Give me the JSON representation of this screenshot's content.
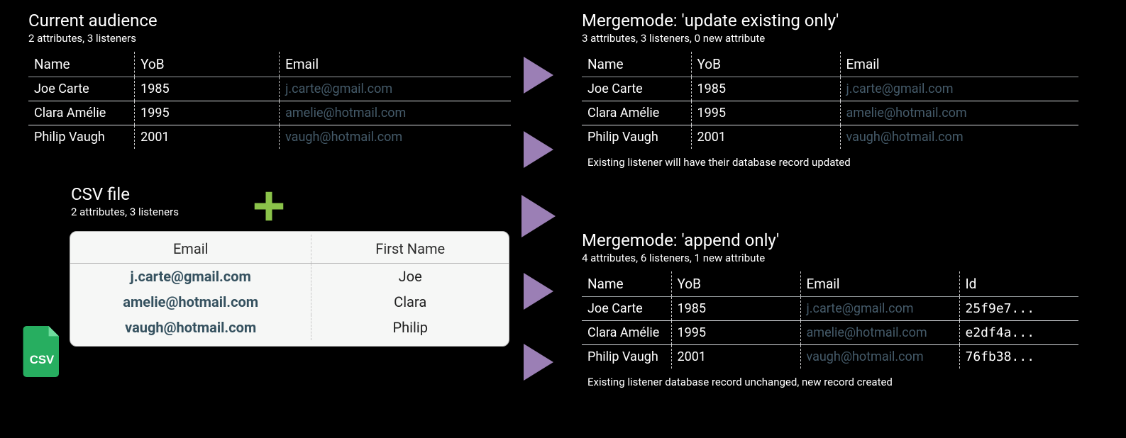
{
  "current_audience": {
    "title": "Current audience",
    "subtitle": "2 attributes, 3 listeners",
    "headers": [
      "Name",
      "YoB",
      "Email"
    ],
    "rows": [
      [
        "Joe Carte",
        "1985",
        "j.carte@gmail.com"
      ],
      [
        "Clara Amélie",
        "1995",
        "amelie@hotmail.com"
      ],
      [
        "Philip Vaugh",
        "2001",
        "vaugh@hotmail.com"
      ]
    ]
  },
  "csv": {
    "title": "CSV file",
    "subtitle": "2 attributes, 3 listeners",
    "headers": [
      "Email",
      "First Name"
    ],
    "rows": [
      [
        "j.carte@gmail.com",
        "Joe"
      ],
      [
        "amelie@hotmail.com",
        "Clara"
      ],
      [
        "vaugh@hotmail.com",
        "Philip"
      ]
    ],
    "badge": "CSV"
  },
  "plus_label": "+",
  "mergemode": {
    "title": "Mergemode: 'update existing only'",
    "subtitle": "3 attributes, 3 listeners, 0 new attribute",
    "headers": [
      "Name",
      "YoB",
      "Email"
    ],
    "rows": [
      [
        "Joe Carte",
        "1985",
        "j.carte@gmail.com"
      ],
      [
        "Clara Amélie",
        "1995",
        "amelie@hotmail.com"
      ],
      [
        "Philip Vaugh",
        "2001",
        "vaugh@hotmail.com"
      ]
    ],
    "note": "Existing listener will have their database record updated"
  },
  "appendmode": {
    "title": "Mergemode: 'append only'",
    "subtitle": "4 attributes, 6 listeners, 1 new attribute",
    "headers": [
      "Name",
      "YoB",
      "Email",
      "Id"
    ],
    "rows_existing": [
      [
        "Joe Carte",
        "1985",
        "j.carte@gmail.com",
        "25f9e7..."
      ],
      [
        "Clara Amélie",
        "1995",
        "amelie@hotmail.com",
        "e2df4a..."
      ],
      [
        "Philip Vaugh",
        "2001",
        "vaugh@hotmail.com",
        "76fb38..."
      ]
    ],
    "note": "Existing listener database record unchanged, new record created"
  }
}
